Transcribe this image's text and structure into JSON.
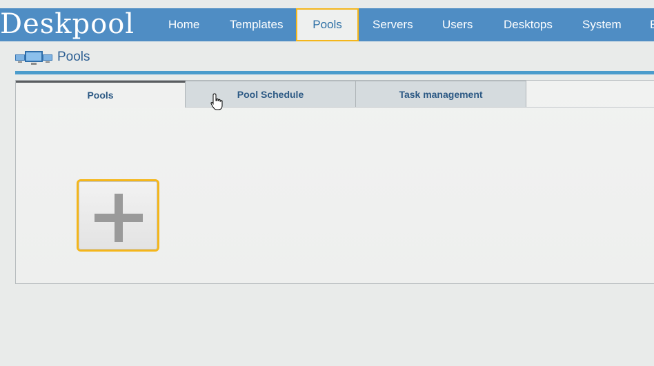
{
  "header": {
    "logo": "Deskpool",
    "nav": [
      "Home",
      "Templates",
      "Pools",
      "Servers",
      "Users",
      "Desktops",
      "System",
      "E"
    ],
    "active_nav": "Pools",
    "accent_color": "#4f8dc4",
    "highlight_color": "#f4b61b"
  },
  "page": {
    "title": "Pools",
    "icon": "monitors-icon"
  },
  "tabs": [
    "Pools",
    "Pool Schedule",
    "Task management"
  ],
  "selected_tab": "Pools",
  "content": {
    "add_button_icon": "plus-icon"
  }
}
